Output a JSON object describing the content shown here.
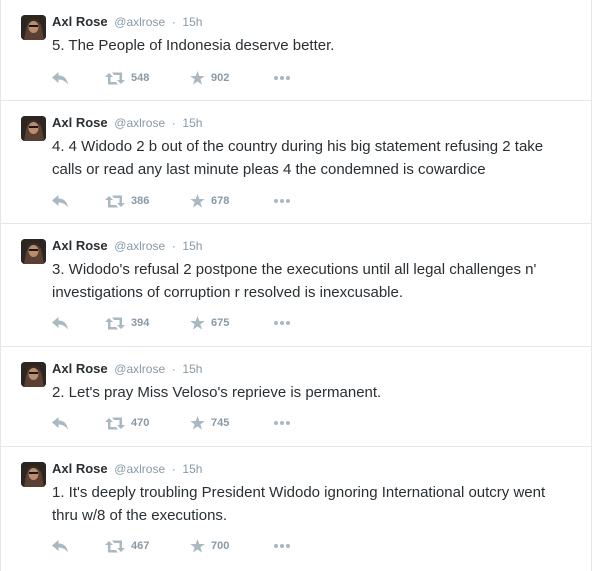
{
  "tweets": [
    {
      "name": "Axl Rose",
      "handle": "@axlrose",
      "sep": "·",
      "time": "15h",
      "text": "5. The People of Indonesia deserve better.",
      "retweets": "548",
      "favorites": "902"
    },
    {
      "name": "Axl Rose",
      "handle": "@axlrose",
      "sep": "·",
      "time": "15h",
      "text": "4. 4 Widodo 2 b out of the country during his big statement refusing 2 take calls or read any last minute pleas 4 the condemned is cowardice",
      "retweets": "386",
      "favorites": "678"
    },
    {
      "name": "Axl Rose",
      "handle": "@axlrose",
      "sep": "·",
      "time": "15h",
      "text": "3. Widodo's refusal 2 postpone the executions until all legal challenges n' investigations of corruption r resolved is inexcusable.",
      "retweets": "394",
      "favorites": "675"
    },
    {
      "name": "Axl Rose",
      "handle": "@axlrose",
      "sep": "·",
      "time": "15h",
      "text": "2. Let's pray Miss Veloso's reprieve is permanent.",
      "retweets": "470",
      "favorites": "745"
    },
    {
      "name": "Axl Rose",
      "handle": "@axlrose",
      "sep": "·",
      "time": "15h",
      "text": "1. It's deeply troubling President Widodo ignoring International outcry went thru w/8 of the executions.",
      "retweets": "467",
      "favorites": "700"
    }
  ],
  "icons": {
    "reply": "reply-icon",
    "retweet": "retweet-icon",
    "favorite": "star-icon",
    "more": "more-dots-icon"
  },
  "colors": {
    "name": "#292f33",
    "meta": "#8899a6",
    "action_icon": "#aab8c2",
    "divider": "#e1e8ed"
  }
}
